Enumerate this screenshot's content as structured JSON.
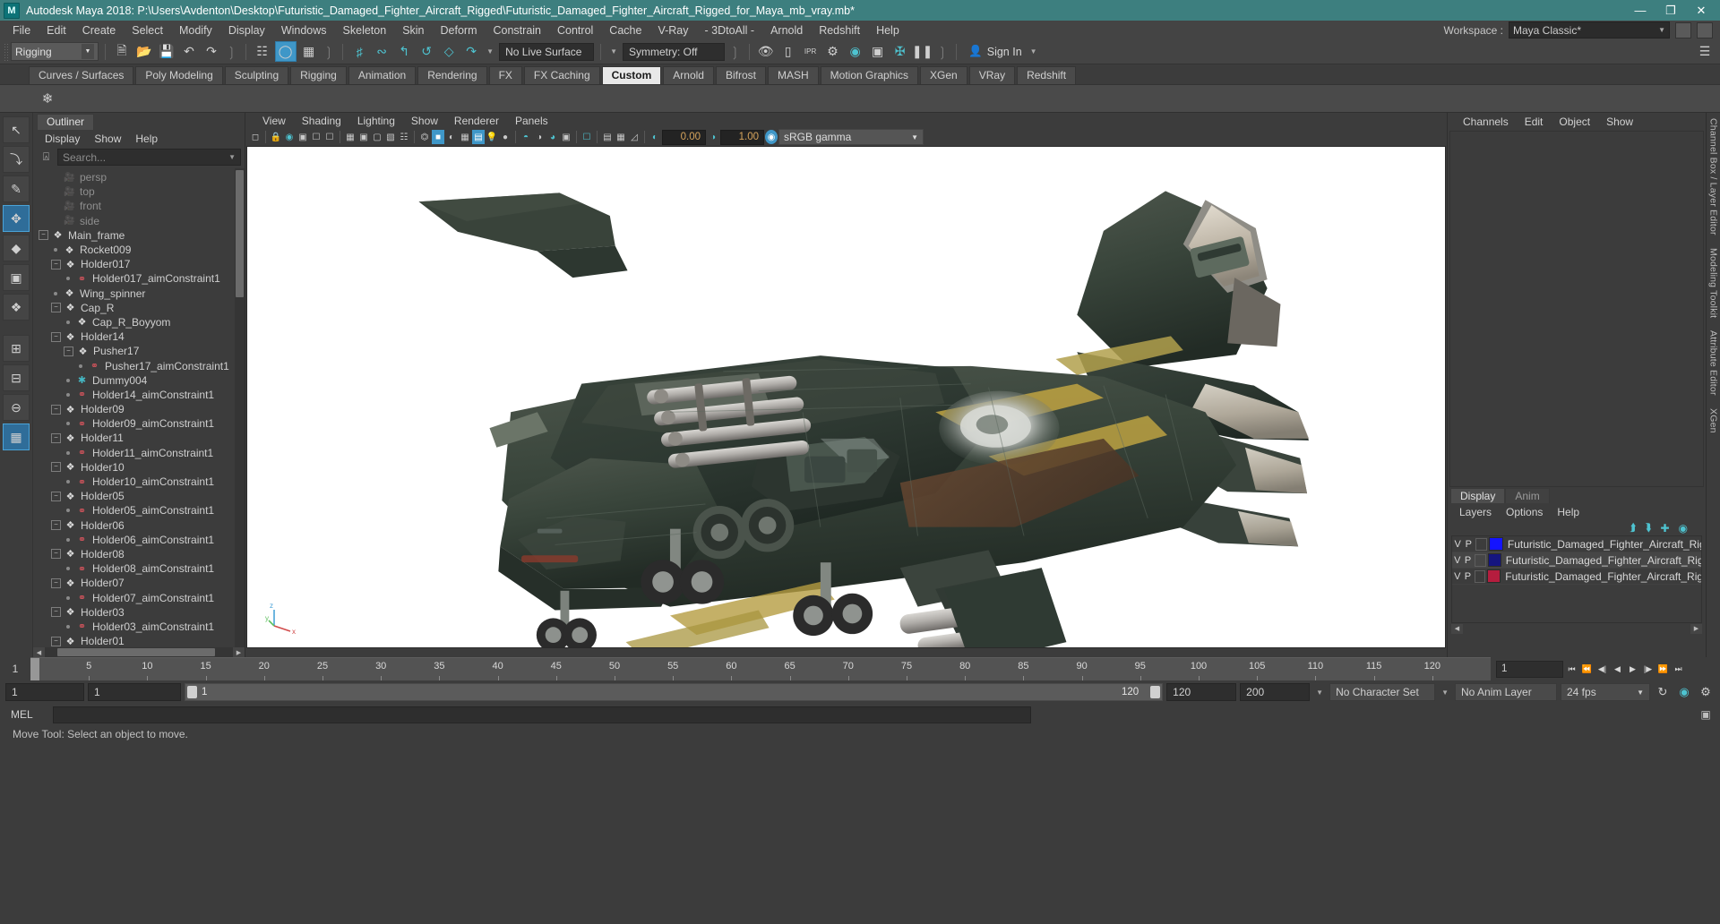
{
  "window": {
    "title": "Autodesk Maya 2018: P:\\Users\\Avdenton\\Desktop\\Futuristic_Damaged_Fighter_Aircraft_Rigged\\Futuristic_Damaged_Fighter_Aircraft_Rigged_for_Maya_mb_vray.mb*",
    "logo": "M",
    "minimize": "—",
    "maximize": "❐",
    "close": "✕",
    "titlebar_color": "#3d7f7f"
  },
  "menubar": {
    "items": [
      "File",
      "Edit",
      "Create",
      "Select",
      "Modify",
      "Display",
      "Windows",
      "Skeleton",
      "Skin",
      "Deform",
      "Constrain",
      "Control",
      "Cache",
      "V-Ray",
      "- 3DtoAll -",
      "Arnold",
      "Redshift",
      "Help"
    ],
    "workspace_label": "Workspace :",
    "workspace_value": "Maya Classic*"
  },
  "toolbar": {
    "mode": "Rigging",
    "live_surface": "No Live Surface",
    "symmetry": "Symmetry: Off",
    "signin": "Sign In",
    "icons": [
      "new-file-icon",
      "open-file-icon",
      "save-file-icon",
      "undo-icon",
      "redo-icon",
      "select-by-hierarchy-icon",
      "select-by-object-icon",
      "select-by-component-icon",
      "snap-to-grid-icon",
      "snap-to-curve-icon",
      "snap-to-point-icon",
      "snap-to-projected-center-icon",
      "snap-to-view-plane-icon",
      "make-live-icon",
      "render-current-frame-icon",
      "render-sequence-icon",
      "ipr-render-icon",
      "render-settings-icon",
      "hypershade-icon",
      "render-view-icon",
      "render-setup-icon",
      "pause-render-icon",
      "person-icon"
    ]
  },
  "shelf": {
    "tabs": [
      "Curves / Surfaces",
      "Poly Modeling",
      "Sculpting",
      "Rigging",
      "Animation",
      "Rendering",
      "FX",
      "FX Caching",
      "Custom",
      "Arnold",
      "Bifrost",
      "MASH",
      "Motion Graphics",
      "XGen",
      "VRay",
      "Redshift"
    ],
    "active_tab": "Custom",
    "strip_icons": [
      "asterisk-tool-icon"
    ]
  },
  "toolbox": {
    "items": [
      {
        "name": "select-tool",
        "glyph": "↖",
        "selected": false
      },
      {
        "name": "lasso-tool",
        "glyph": "⤵",
        "selected": false
      },
      {
        "name": "paint-select-tool",
        "glyph": "✎",
        "selected": false
      },
      {
        "name": "move-tool",
        "glyph": "✥",
        "selected": true
      },
      {
        "name": "rotate-tool",
        "glyph": "◆",
        "selected": false
      },
      {
        "name": "scale-tool",
        "glyph": "▣",
        "selected": false
      },
      {
        "name": "last-tool",
        "glyph": "❖",
        "selected": false
      },
      {
        "name": "single-pane-layout-icon",
        "glyph": "⊞",
        "selected": false
      },
      {
        "name": "two-pane-layout-icon",
        "glyph": "⊟",
        "selected": false
      },
      {
        "name": "four-pane-layout-icon",
        "glyph": "⊖",
        "selected": false
      },
      {
        "name": "persp-layout-icon",
        "glyph": "▦",
        "selected": true
      }
    ]
  },
  "outliner": {
    "tab": "Outliner",
    "menus": [
      "Display",
      "Show",
      "Help"
    ],
    "search_placeholder": "Search...",
    "search_icon": "select-hierarchy-icon",
    "nodes": [
      {
        "label": "persp",
        "icon": "camera-icon",
        "depth": 1,
        "toggle": "none",
        "dim": true
      },
      {
        "label": "top",
        "icon": "camera-icon",
        "depth": 1,
        "toggle": "none",
        "dim": true
      },
      {
        "label": "front",
        "icon": "camera-icon",
        "depth": 1,
        "toggle": "none",
        "dim": true
      },
      {
        "label": "side",
        "icon": "camera-icon",
        "depth": 1,
        "toggle": "none",
        "dim": true
      },
      {
        "label": "Main_frame",
        "icon": "transform-icon",
        "depth": 0,
        "toggle": "minus",
        "dim": false
      },
      {
        "label": "Rocket009",
        "icon": "transform-icon",
        "depth": 1,
        "toggle": "dot",
        "dim": false
      },
      {
        "label": "Holder017",
        "icon": "transform-icon",
        "depth": 1,
        "toggle": "minus",
        "dim": false
      },
      {
        "label": "Holder017_aimConstraint1",
        "icon": "constraint-icon",
        "depth": 2,
        "toggle": "dot",
        "dim": false
      },
      {
        "label": "Wing_spinner",
        "icon": "transform-icon",
        "depth": 1,
        "toggle": "dot",
        "dim": false
      },
      {
        "label": "Cap_R",
        "icon": "transform-icon",
        "depth": 1,
        "toggle": "minus",
        "dim": false
      },
      {
        "label": "Cap_R_Boyyom",
        "icon": "transform-icon",
        "depth": 2,
        "toggle": "dot",
        "dim": false
      },
      {
        "label": "Holder14",
        "icon": "transform-icon",
        "depth": 1,
        "toggle": "minus",
        "dim": false
      },
      {
        "label": "Pusher17",
        "icon": "transform-icon",
        "depth": 2,
        "toggle": "minus",
        "dim": false
      },
      {
        "label": "Pusher17_aimConstraint1",
        "icon": "constraint-icon",
        "depth": 3,
        "toggle": "dot",
        "dim": false
      },
      {
        "label": "Dummy004",
        "icon": "locator-icon",
        "depth": 2,
        "toggle": "dot",
        "dim": false
      },
      {
        "label": "Holder14_aimConstraint1",
        "icon": "constraint-icon",
        "depth": 2,
        "toggle": "dot",
        "dim": false
      },
      {
        "label": "Holder09",
        "icon": "transform-icon",
        "depth": 1,
        "toggle": "minus",
        "dim": false
      },
      {
        "label": "Holder09_aimConstraint1",
        "icon": "constraint-icon",
        "depth": 2,
        "toggle": "dot",
        "dim": false
      },
      {
        "label": "Holder11",
        "icon": "transform-icon",
        "depth": 1,
        "toggle": "minus",
        "dim": false
      },
      {
        "label": "Holder11_aimConstraint1",
        "icon": "constraint-icon",
        "depth": 2,
        "toggle": "dot",
        "dim": false
      },
      {
        "label": "Holder10",
        "icon": "transform-icon",
        "depth": 1,
        "toggle": "minus",
        "dim": false
      },
      {
        "label": "Holder10_aimConstraint1",
        "icon": "constraint-icon",
        "depth": 2,
        "toggle": "dot",
        "dim": false
      },
      {
        "label": "Holder05",
        "icon": "transform-icon",
        "depth": 1,
        "toggle": "minus",
        "dim": false
      },
      {
        "label": "Holder05_aimConstraint1",
        "icon": "constraint-icon",
        "depth": 2,
        "toggle": "dot",
        "dim": false
      },
      {
        "label": "Holder06",
        "icon": "transform-icon",
        "depth": 1,
        "toggle": "minus",
        "dim": false
      },
      {
        "label": "Holder06_aimConstraint1",
        "icon": "constraint-icon",
        "depth": 2,
        "toggle": "dot",
        "dim": false
      },
      {
        "label": "Holder08",
        "icon": "transform-icon",
        "depth": 1,
        "toggle": "minus",
        "dim": false
      },
      {
        "label": "Holder08_aimConstraint1",
        "icon": "constraint-icon",
        "depth": 2,
        "toggle": "dot",
        "dim": false
      },
      {
        "label": "Holder07",
        "icon": "transform-icon",
        "depth": 1,
        "toggle": "minus",
        "dim": false
      },
      {
        "label": "Holder07_aimConstraint1",
        "icon": "constraint-icon",
        "depth": 2,
        "toggle": "dot",
        "dim": false
      },
      {
        "label": "Holder03",
        "icon": "transform-icon",
        "depth": 1,
        "toggle": "minus",
        "dim": false
      },
      {
        "label": "Holder03_aimConstraint1",
        "icon": "constraint-icon",
        "depth": 2,
        "toggle": "dot",
        "dim": false
      },
      {
        "label": "Holder01",
        "icon": "transform-icon",
        "depth": 1,
        "toggle": "minus",
        "dim": false
      }
    ]
  },
  "viewport": {
    "menus": [
      "View",
      "Shading",
      "Lighting",
      "Show",
      "Renderer",
      "Panels"
    ],
    "exposure": "0.00",
    "gamma": "1.00",
    "color_profile": "sRGB gamma",
    "axis_labels": {
      "z": "z",
      "y": "y",
      "x": "x"
    },
    "background": "#ffffff",
    "subject": "Futuristic damaged fighter aircraft 3D model"
  },
  "channelbox": {
    "menus": [
      "Channels",
      "Edit",
      "Object",
      "Show"
    ],
    "vertical_tabs": [
      "Channel Box / Layer Editor",
      "Modeling Toolkit",
      "Attribute Editor",
      "XGen"
    ]
  },
  "layers": {
    "tabs": [
      "Display",
      "Anim"
    ],
    "active_tab": "Display",
    "menus": [
      "Layers",
      "Options",
      "Help"
    ],
    "toolbar_icons": [
      "move-layer-up-icon",
      "move-layer-down-icon",
      "new-layer-icon",
      "new-layer-from-selected-icon"
    ],
    "rows": [
      {
        "v": "V",
        "p": "P",
        "color": "#1414ff",
        "name": "Futuristic_Damaged_Fighter_Aircraft_Rigged_Hel"
      },
      {
        "v": "V",
        "p": "P",
        "color": "#151580",
        "name": "Futuristic_Damaged_Fighter_Aircraft_Rigged_Geom"
      },
      {
        "v": "V",
        "p": "P",
        "color": "#b51d3e",
        "name": "Futuristic_Damaged_Fighter_Aircraft_Rigged_Contro"
      }
    ]
  },
  "timeline": {
    "current_frame": "1",
    "ticks": [
      "5",
      "10",
      "15",
      "20",
      "25",
      "30",
      "35",
      "40",
      "45",
      "50",
      "55",
      "60",
      "65",
      "70",
      "75",
      "80",
      "85",
      "90",
      "95",
      "100",
      "105",
      "110",
      "115",
      "120"
    ],
    "frame_field": "1",
    "transport_icons": [
      "go-to-start-icon",
      "step-back-key-icon",
      "step-back-frame-icon",
      "play-backwards-icon",
      "play-forwards-icon",
      "step-forward-frame-icon",
      "step-forward-key-icon",
      "go-to-end-icon"
    ]
  },
  "playback": {
    "anim_start": "1",
    "range_start": "1",
    "slider_start_label": "1",
    "slider_end_label": "120",
    "range_end": "120",
    "anim_end": "200",
    "character_set": "No Character Set",
    "anim_layer": "No Anim Layer",
    "fps": "24 fps",
    "icons": [
      "auto-key-icon",
      "animation-preferences-icon",
      "playback-loop-icon"
    ]
  },
  "commandline": {
    "label": "MEL",
    "input_value": "",
    "script-editor-icon": "script-editor-icon"
  },
  "status": {
    "message": "Move Tool: Select an object to move."
  }
}
